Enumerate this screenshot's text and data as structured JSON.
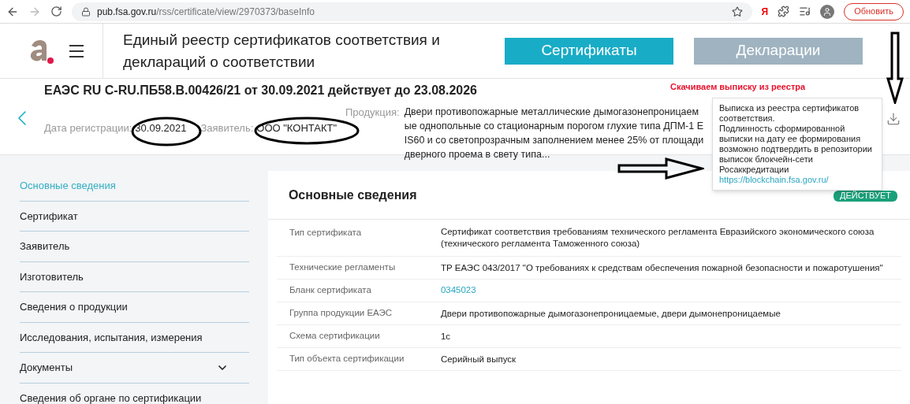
{
  "browser": {
    "url_host": "pub.fsa.gov.ru",
    "url_path": "/rss/certificate/view/2970373/baseInfo",
    "yandex_label": "Я",
    "update_button": "Обновить"
  },
  "header": {
    "title": "Единый реестр сертификатов соответствия и деклараций о соответствии",
    "tabs": [
      {
        "label": "Сертификаты",
        "selected": true
      },
      {
        "label": "Декларации",
        "selected": false
      }
    ]
  },
  "certificate": {
    "title": "ЕАЭС RU C-RU.ПБ58.В.00426/21 от 30.09.2021 действует до 23.08.2026",
    "registration_label": "Дата регистрации:",
    "registration_date": "30.09.2021",
    "applicant_label": "Заявитель:",
    "applicant": "ООО \"КОНТАКТ\"",
    "product_label": "Продукция:",
    "product": "Двери противопожарные металлические дымогазонепроницаемые однопольные со стационарным порогом глухие типа ДПМ-1 EIS60 и со светопрозрачным заполнением менее 25% от площади дверного проема в свету типа..."
  },
  "annotation": {
    "note": "Скачиваем выписку из реестра"
  },
  "tooltip": {
    "text": "Выписка из реестра сертификатов соответствия.\nПодлинность сформированной выписки на дату ее формирования возможно подтвердить в репозитории выписок блокчейн-сети Росаккредитации",
    "link": "https://blockchain.fsa.gov.ru/"
  },
  "sidebar": {
    "items": [
      {
        "label": "Основные сведения",
        "selected": true,
        "kind": "link"
      },
      {
        "label": "Сертификат",
        "selected": false,
        "kind": "link"
      },
      {
        "label": "Заявитель",
        "selected": false,
        "kind": "link"
      },
      {
        "label": "Изготовитель",
        "selected": false,
        "kind": "link"
      },
      {
        "label": "Сведения о продукции",
        "selected": false,
        "kind": "link"
      },
      {
        "label": "Исследования, испытания, измерения",
        "selected": false,
        "kind": "link"
      },
      {
        "label": "Документы",
        "selected": false,
        "kind": "group"
      },
      {
        "label": "Сведения об органе по сертификации",
        "selected": false,
        "kind": "link"
      }
    ]
  },
  "card": {
    "title": "Основные сведения",
    "status": "ДЕЙСТВУЕТ",
    "rows": [
      {
        "label": "Тип сертификата",
        "value": "Сертификат соответствия требованиям технического регламента Евразийского экономического союза (технического регламента Таможенного союза)",
        "kind": "text"
      },
      {
        "label": "Технические регламенты",
        "value": "ТР ЕАЭС 043/2017 \"О требованиях к средствам обеспечения пожарной безопасности и пожаротушения\"",
        "kind": "text"
      },
      {
        "label": "Бланк сертификата",
        "value": "0345023",
        "kind": "link"
      },
      {
        "label": "Группа продукции ЕАЭС",
        "value": "Двери противопожарные дымогазонепроницаемые, двери дымонепроницаемые",
        "kind": "text"
      },
      {
        "label": "Схема сертификации",
        "value": "1с",
        "kind": "text"
      },
      {
        "label": "Тип объекта сертификации",
        "value": "Серийный выпуск",
        "kind": "text"
      }
    ]
  }
}
